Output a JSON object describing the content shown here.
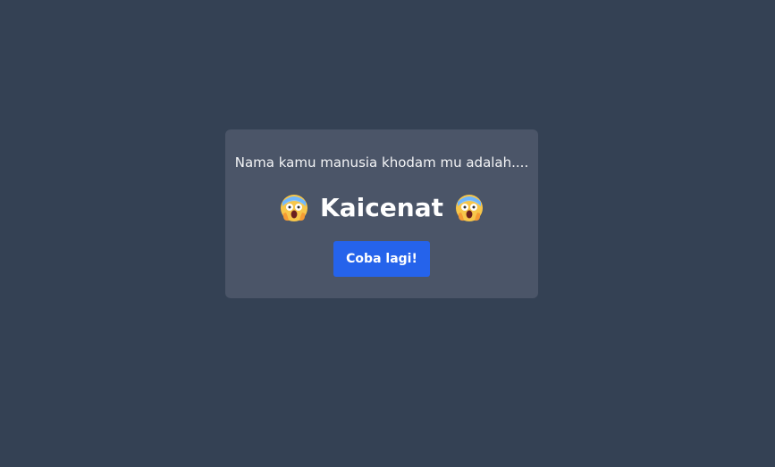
{
  "result": {
    "intro_text": "Nama kamu manusia khodam mu adalah....",
    "khodam_name": "Kaicenat",
    "left_icon": "screaming-face-emoji",
    "right_icon": "screaming-face-emoji"
  },
  "actions": {
    "retry_label": "Coba lagi!"
  },
  "colors": {
    "background": "#344154",
    "card": "#4b5568",
    "button": "#2563eb",
    "text": "#ffffff"
  }
}
